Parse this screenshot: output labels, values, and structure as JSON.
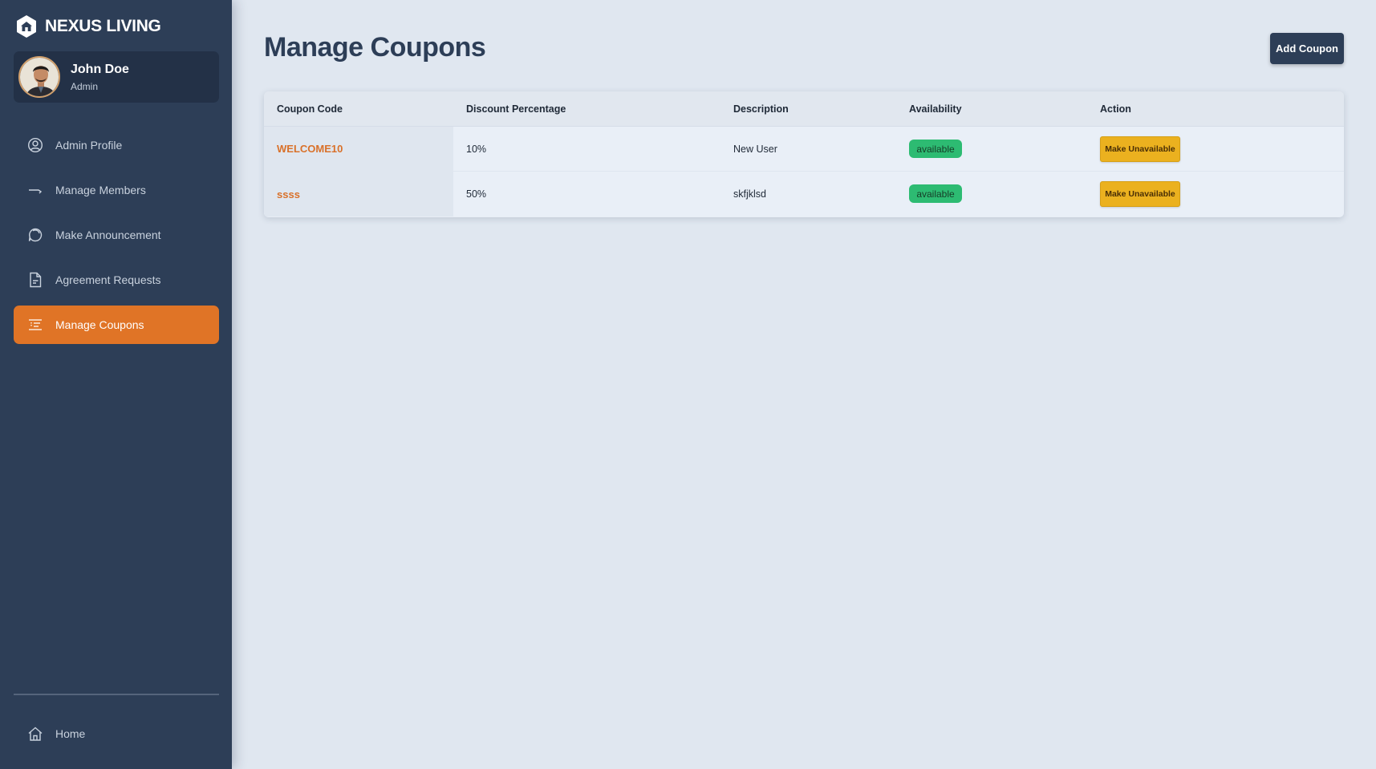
{
  "brand": {
    "name": "NEXUS LIVING",
    "icon": "house-hexagon-icon"
  },
  "user": {
    "name": "John Doe",
    "role": "Admin"
  },
  "nav": {
    "items": [
      {
        "label": "Admin Profile",
        "icon": "user-circle-icon"
      },
      {
        "label": "Manage Members",
        "icon": "arrow-members-icon"
      },
      {
        "label": "Make Announcement",
        "icon": "chat-bubble-icon"
      },
      {
        "label": "Agreement Requests",
        "icon": "document-icon"
      },
      {
        "label": "Manage Coupons",
        "icon": "coupon-list-icon",
        "active": true
      }
    ],
    "home": {
      "label": "Home",
      "icon": "home-icon"
    }
  },
  "page": {
    "title": "Manage Coupons",
    "add_button": "Add Coupon"
  },
  "table": {
    "headers": [
      "Coupon Code",
      "Discount Percentage",
      "Description",
      "Availability",
      "Action"
    ],
    "rows": [
      {
        "code": "WELCOME10",
        "discount": "10%",
        "description": "New User",
        "availability": "available",
        "action": "Make Unavailable"
      },
      {
        "code": "ssss",
        "discount": "50%",
        "description": "skfjklsd",
        "availability": "available",
        "action": "Make Unavailable"
      }
    ]
  },
  "colors": {
    "sidebar": "#2d3e57",
    "accent": "#e07426",
    "available": "#2dbb72",
    "warning_button": "#ebb11f"
  }
}
